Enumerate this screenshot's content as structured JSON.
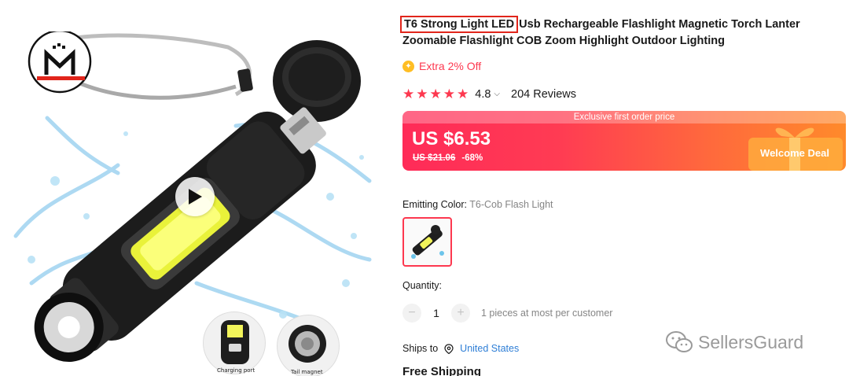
{
  "brand": {
    "logo_alt": "M logo"
  },
  "gallery": {
    "thumb_left_label": "Charging port",
    "thumb_right_label": "Tail magnet"
  },
  "product": {
    "title_highlight": "T6 Strong Light LED",
    "title_rest": " Usb Rechargeable Flashlight Magnetic Torch Lanter Zoomable Flashlight COB Zoom Highlight Outdoor Lighting",
    "extra_discount": "Extra 2% Off",
    "rating_score": "4.8",
    "rating_stars": 5,
    "reviews": "204 Reviews"
  },
  "price": {
    "banner": "Exclusive first order price",
    "current": "US $6.53",
    "original": "US $21.06",
    "discount": "-68%",
    "deal_label": "Welcome Deal"
  },
  "options": {
    "color_label": "Emitting Color:",
    "color_value": " T6-Cob Flash Light"
  },
  "quantity": {
    "label": "Quantity:",
    "value": "1",
    "minus": "−",
    "plus": "+",
    "limit": "1 pieces at most per customer"
  },
  "shipping": {
    "ships_to": "Ships to",
    "country": "United States",
    "free_shipping": "Free Shipping"
  },
  "watermark": {
    "text": "SellersGuard"
  },
  "colors": {
    "accent": "#fd384f",
    "link": "#2e7ed6",
    "coin": "#ffbe24"
  }
}
